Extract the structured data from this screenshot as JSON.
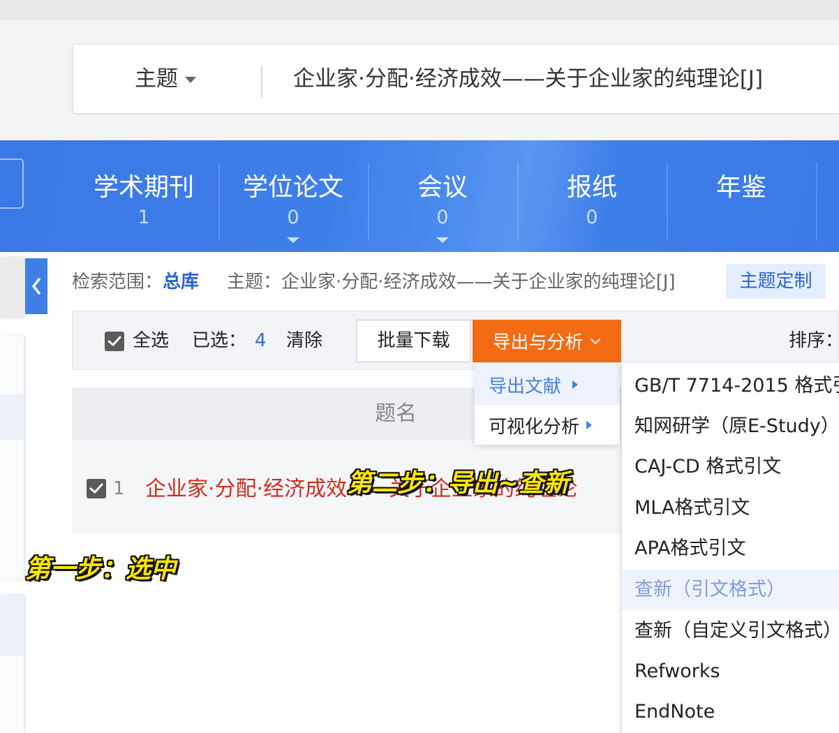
{
  "search": {
    "field_label": "主题",
    "query": "企业家·分配·经济成效——关于企业家的纯理论[J]"
  },
  "tabs": [
    {
      "label": "学术期刊",
      "count": "1"
    },
    {
      "label": "学位论文",
      "count": "0"
    },
    {
      "label": "会议",
      "count": "0"
    },
    {
      "label": "报纸",
      "count": "0"
    },
    {
      "label": "年鉴"
    }
  ],
  "scope": {
    "label": "检索范围：",
    "value": "总库",
    "topic_label": "主题：",
    "topic_value": "企业家·分配·经济成效——关于企业家的纯理论[J]",
    "customize_button": "主题定制"
  },
  "toolbar": {
    "select_all": "全选",
    "selected_label": "已选：",
    "selected_count": "4",
    "clear": "清除",
    "batch_download": "批量下载",
    "export_analyze": "导出与分析",
    "sort_label": "排序："
  },
  "export_menu": [
    {
      "label": "导出文献"
    },
    {
      "label": "可视化分析"
    }
  ],
  "export_submenu": [
    {
      "label": "GB/T 7714-2015 格式引"
    },
    {
      "label": "知网研学（原E-Study）"
    },
    {
      "label": "CAJ-CD 格式引文"
    },
    {
      "label": "MLA格式引文"
    },
    {
      "label": "APA格式引文"
    },
    {
      "label": "查新（引文格式）"
    },
    {
      "label": "查新（自定义引文格式）"
    },
    {
      "label": "Refworks"
    },
    {
      "label": "EndNote"
    }
  ],
  "table": {
    "header_title": "题名",
    "rows": [
      {
        "index": "1",
        "title": "企业家·分配·经济成效——关于企业家的纯理论"
      }
    ]
  },
  "annotations": {
    "step1": "第一步：选中",
    "step2": "第二步：导出~查新"
  },
  "colors": {
    "primary_blue": "#3f7fe8",
    "export_orange": "#f36b12",
    "title_red": "#d42a1f",
    "annotation_yellow": "#ffe600"
  },
  "icons": {
    "field_dropdown": "caret-down-icon",
    "collapse": "chevron-left-icon",
    "checkbox": "checkbox-checked-icon",
    "export_dropdown": "chevron-down-icon",
    "submenu_arrow": "caret-right-icon"
  }
}
